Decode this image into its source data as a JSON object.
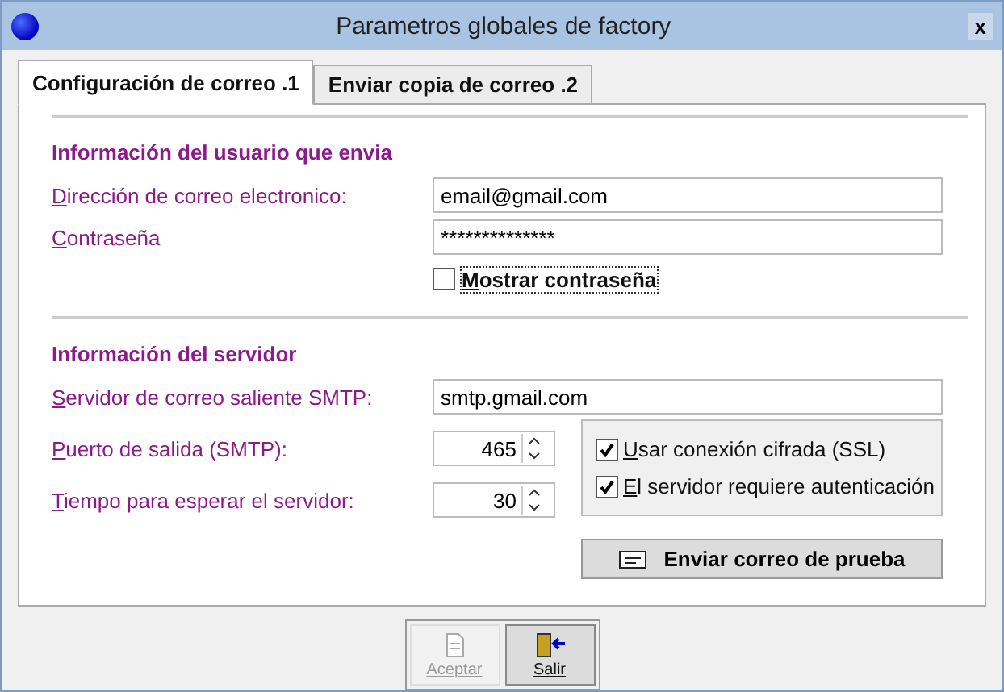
{
  "window": {
    "title": "Parametros globales de factory",
    "close": "x"
  },
  "tabs": [
    {
      "label": "Configuración de correo .1",
      "selected": true
    },
    {
      "label": "Enviar copia de correo .2",
      "selected": false
    }
  ],
  "user_section": {
    "heading": "Información del usuario que envia",
    "email": {
      "label": "Dirección de correo electronico:",
      "value": "email@gmail.com"
    },
    "password": {
      "label": "Contraseña",
      "value": "**************"
    },
    "show_password": {
      "label": "Mostrar contraseña",
      "checked": false
    }
  },
  "server_section": {
    "heading": "Información del servidor",
    "smtp_server": {
      "label": "Servidor de correo saliente SMTP:",
      "value": "smtp.gmail.com"
    },
    "port": {
      "label": "Puerto de salida (SMTP):",
      "value": "465"
    },
    "timeout": {
      "label": "Tiempo para esperar el servidor:",
      "value": "30"
    },
    "options": [
      {
        "label": "Usar conexión cifrada (SSL)",
        "checked": true
      },
      {
        "label": "El servidor requiere autenticación",
        "checked": true
      }
    ],
    "test_button": "Enviar correo de prueba"
  },
  "buttons": [
    {
      "label": "Aceptar",
      "disabled": true
    },
    {
      "label": "Salir",
      "disabled": false
    }
  ]
}
